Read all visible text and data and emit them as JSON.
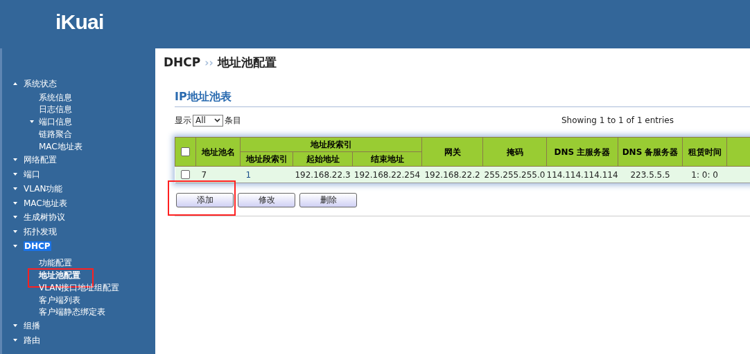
{
  "logo": "iKuai",
  "sidebar": {
    "items": [
      {
        "label": "系统状态",
        "caret_up": true,
        "selected": false,
        "children": [
          {
            "label": "系统信息",
            "selected": false
          },
          {
            "label": "日志信息",
            "selected": false
          },
          {
            "label": "端口信息",
            "caret_up": false,
            "selected": false
          },
          {
            "label": "链路聚合",
            "selected": false
          },
          {
            "label": "MAC地址表",
            "selected": false
          }
        ]
      },
      {
        "label": "网络配置",
        "caret_up": false,
        "selected": false
      },
      {
        "label": "端口",
        "caret_up": false,
        "selected": false
      },
      {
        "label": "VLAN功能",
        "caret_up": false,
        "selected": false
      },
      {
        "label": "MAC地址表",
        "caret_up": false,
        "selected": false
      },
      {
        "label": "生成树协议",
        "caret_up": false,
        "selected": false
      },
      {
        "label": "拓扑发现",
        "caret_up": false,
        "selected": false
      },
      {
        "label": "DHCP",
        "caret_up": false,
        "selected": true,
        "children": [
          {
            "label": "功能配置",
            "selected": false
          },
          {
            "label": "地址池配置",
            "selected": true,
            "highlighted": true
          },
          {
            "label": "VLAN接口地址组配置",
            "selected": false
          },
          {
            "label": "客户端列表",
            "selected": false
          },
          {
            "label": "客户端静态绑定表",
            "selected": false
          }
        ]
      },
      {
        "label": "组播",
        "caret_up": false,
        "selected": false
      },
      {
        "label": "路由",
        "caret_up": false,
        "selected": false
      }
    ]
  },
  "breadcrumb": {
    "parent": "DHCP",
    "separator": "››",
    "current": "地址池配置"
  },
  "section_title": "IP地址池表",
  "length_control": {
    "before": "显示",
    "value": "All",
    "after": "条目"
  },
  "info": "Showing 1 to 1 of 1 entries",
  "table": {
    "select_all_checked": false,
    "group_header": "地址段索引",
    "columns": [
      "地址池名",
      "地址段索引",
      "起始地址",
      "结束地址",
      "网关",
      "掩码",
      "DNS 主服务器",
      "DNS 备服务器",
      "租赁时间"
    ],
    "rows": [
      {
        "checked": false,
        "cells": [
          "7",
          "1",
          "192.168.22.3",
          "192.168.22.254",
          "192.168.22.2",
          "255.255.255.0",
          "114.114.114.114",
          "223.5.5.5",
          "1: 0: 0"
        ]
      }
    ]
  },
  "buttons": [
    {
      "label": "添加",
      "highlighted": true
    },
    {
      "label": "修改",
      "highlighted": false
    },
    {
      "label": "删除",
      "highlighted": false
    }
  ]
}
